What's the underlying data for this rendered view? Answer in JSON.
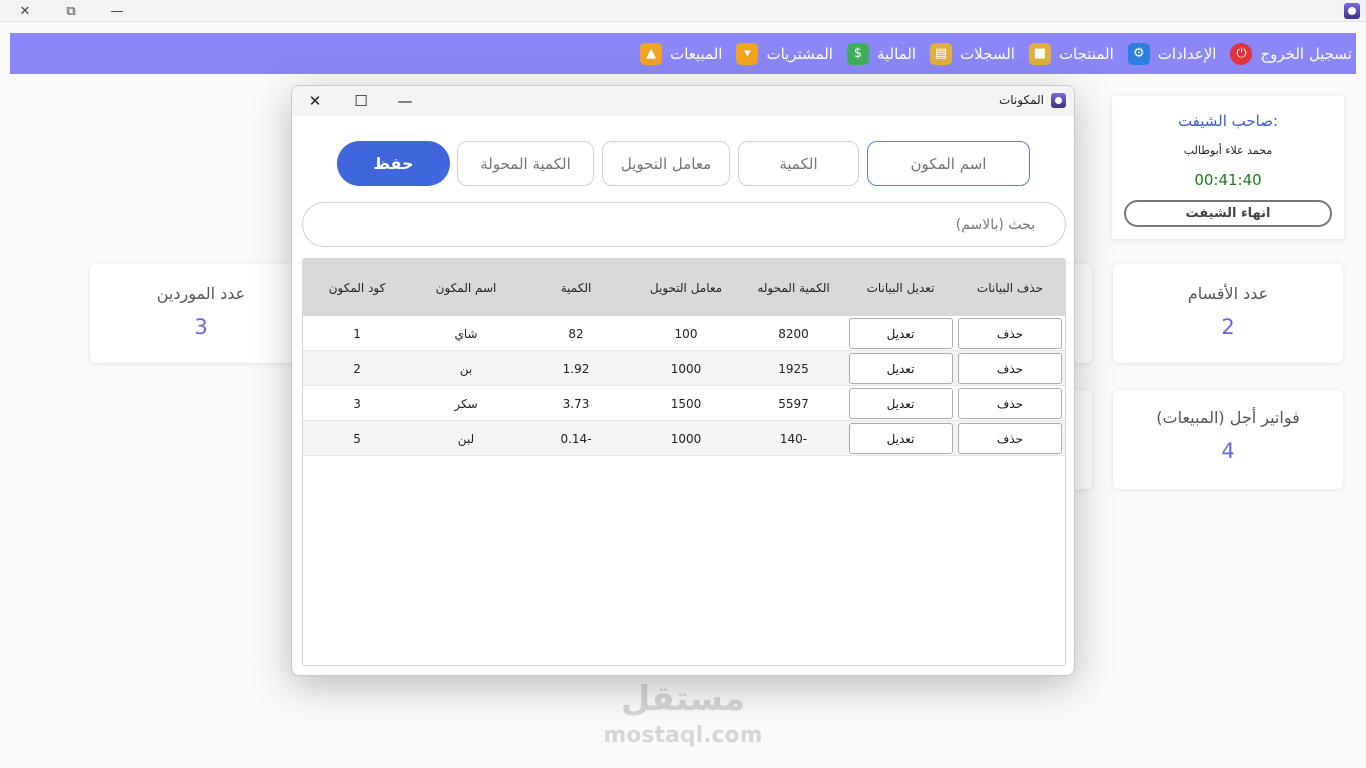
{
  "window": {
    "minimize_glyph": "—",
    "restore_glyph": "⧉",
    "close_glyph": "✕"
  },
  "nav": {
    "items": [
      {
        "label": "المبيعات",
        "icon": "chart-growth-icon",
        "color": "#f4a321"
      },
      {
        "label": "المشتريات",
        "icon": "shopping-cart-icon",
        "color": "#f4a321"
      },
      {
        "label": "المالية",
        "icon": "money-icon",
        "color": "#3fae5a"
      },
      {
        "label": "السجلات",
        "icon": "archive-box-icon",
        "color": "#e2b13c"
      },
      {
        "label": "المنتجات",
        "icon": "products-icon",
        "color": "#e2b13c"
      },
      {
        "label": "الإعدادات",
        "icon": "gear-icon",
        "color": "#2a7fe0"
      },
      {
        "label": "تسجيل الخروج",
        "icon": "logout-icon",
        "color": "#e0333a"
      }
    ]
  },
  "shift": {
    "title": "صاحب الشيفت:",
    "owner": "محمد علاء أبوطالب",
    "timer": "00:41:40",
    "end_label": "انهاء الشيفت"
  },
  "cards": {
    "departments": {
      "title": "عدد الأقسام",
      "value": "2"
    },
    "suppliers": {
      "title": "عدد الموردين",
      "value": "3"
    },
    "credit_invoices": {
      "title": "فواتير أجل (المبيعات)",
      "value": "4"
    }
  },
  "dialog": {
    "title": "المكونات",
    "minimize_glyph": "—",
    "maximize_glyph": "☐",
    "close_glyph": "✕",
    "placeholders": {
      "name": "اسم المكون",
      "quantity": "الكمية",
      "factor": "معامل التحويل",
      "converted": "الكمية المحولة",
      "search": "بحث (بالاسم)"
    },
    "save_label": "حفظ",
    "columns": [
      "كود المكون",
      "اسم المكون",
      "الكمية",
      "معامل التحويل",
      "الكمية المحوله",
      "تعديل البيانات",
      "حذف البيانات"
    ],
    "edit_label": "تعديل",
    "delete_label": "حذف",
    "rows": [
      {
        "code": "1",
        "name": "شاي",
        "qty": "82",
        "factor": "100",
        "converted": "8200"
      },
      {
        "code": "2",
        "name": "بن",
        "qty": "1.92",
        "factor": "1000",
        "converted": "1925"
      },
      {
        "code": "3",
        "name": "سكر",
        "qty": "3.73",
        "factor": "1500",
        "converted": "5597"
      },
      {
        "code": "5",
        "name": "لبن",
        "qty": "-0.14",
        "factor": "1000",
        "converted": "-140"
      }
    ]
  },
  "watermark": {
    "arabic": "مستقل",
    "latin": "mostaql.com"
  }
}
